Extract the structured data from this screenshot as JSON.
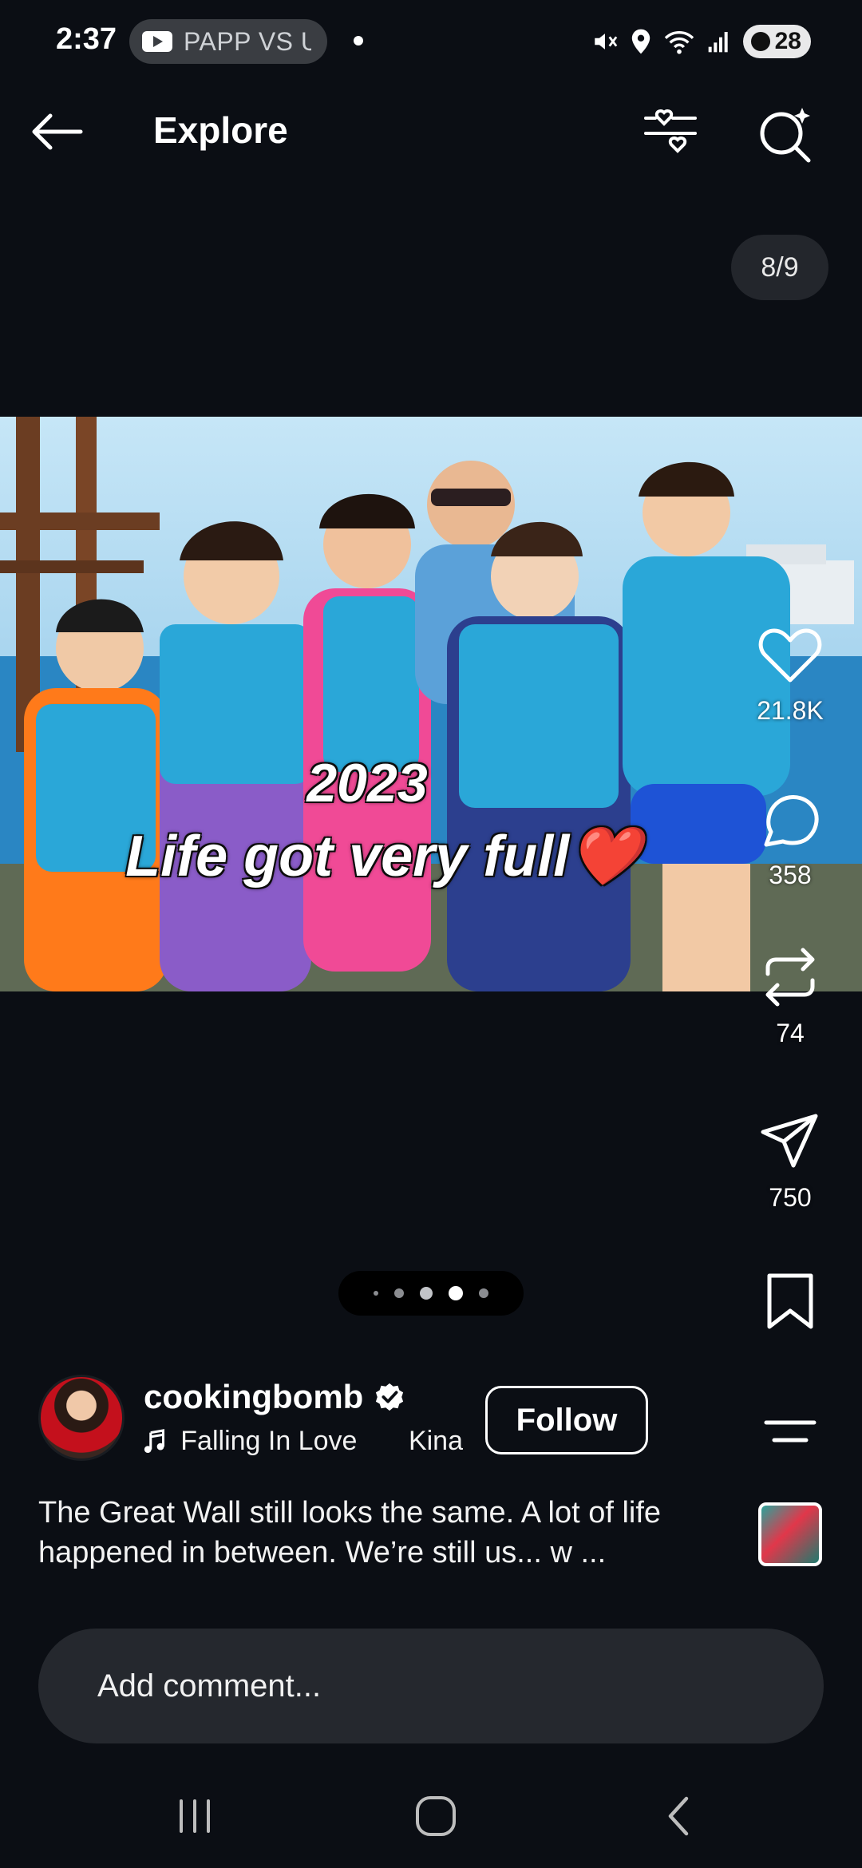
{
  "status_bar": {
    "time": "2:37",
    "media_pill_text": "PAPP VS U",
    "battery": "28",
    "icons": [
      "mute-icon",
      "location-icon",
      "wifi-icon",
      "signal-icon"
    ]
  },
  "header": {
    "title": "Explore",
    "back_icon": "back-arrow-icon",
    "filter_icon": "heart-sliders-icon",
    "search_icon": "search-sparkle-icon"
  },
  "carousel": {
    "counter": "8/9",
    "caption_year": "2023",
    "caption_text": "Life got very full❤️",
    "dots_total": 5,
    "dots_active_index": 3
  },
  "actions": {
    "likes": "21.8K",
    "comments": "358",
    "reposts": "74",
    "shares": "750"
  },
  "author": {
    "username": "cookingbomb",
    "verified": true,
    "music_title": "Falling In Love",
    "music_artist": "Kina",
    "follow_label": "Follow"
  },
  "post": {
    "description": "The Great Wall still looks the same. A lot of life happened in between. We’re still us... w ..."
  },
  "comment": {
    "placeholder": "Add comment..."
  },
  "colors": {
    "background": "#0b0e14",
    "pill": "#23262c",
    "comment_bar": "#25282e"
  }
}
